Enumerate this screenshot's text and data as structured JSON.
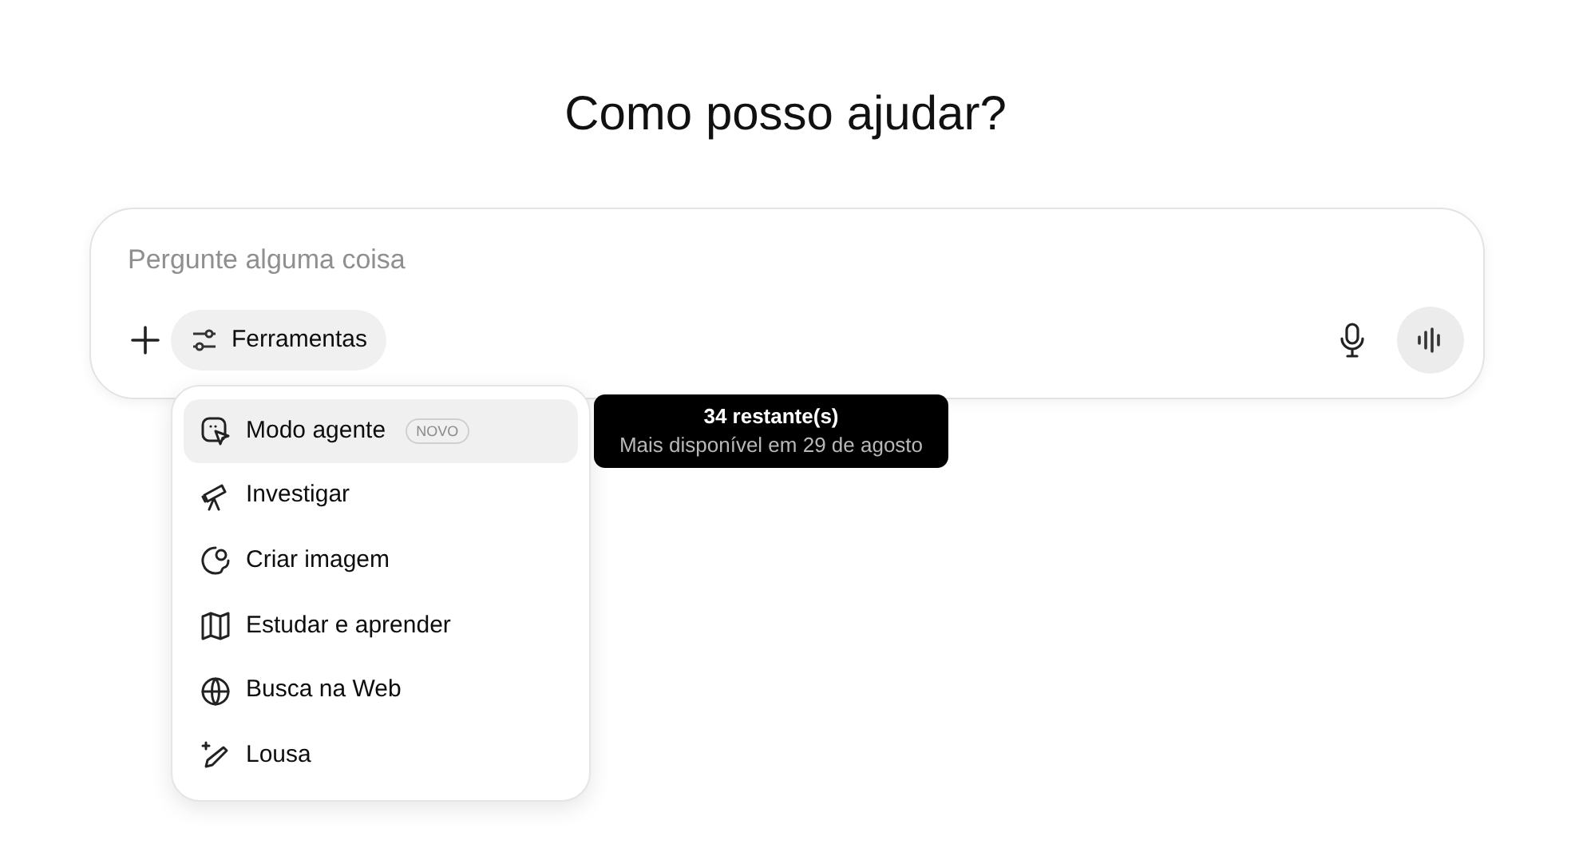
{
  "heading": "Como posso ajudar?",
  "composer": {
    "placeholder": "Pergunte alguma coisa",
    "tools_button": "Ferramentas"
  },
  "tools_menu": [
    {
      "label": "Modo agente",
      "badge": "NOVO",
      "selected": true
    },
    {
      "label": "Investigar",
      "selected": false
    },
    {
      "label": "Criar imagem",
      "selected": false
    },
    {
      "label": "Estudar e aprender",
      "selected": false
    },
    {
      "label": "Busca na Web",
      "selected": false
    },
    {
      "label": "Lousa",
      "selected": false
    }
  ],
  "tooltip": {
    "title": "34 restante(s)",
    "subtitle": "Mais disponível em 29 de agosto"
  }
}
